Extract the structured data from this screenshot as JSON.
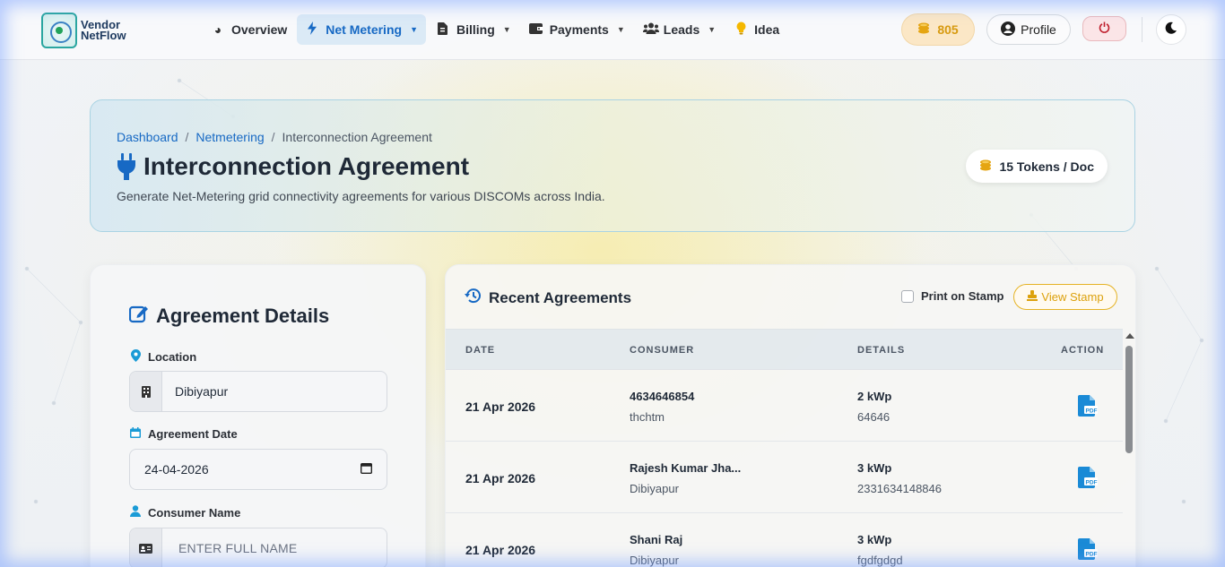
{
  "brand": {
    "line1": "Vendor",
    "line2": "NetFlow"
  },
  "nav": {
    "items": [
      {
        "label": "Overview",
        "icon": "chart-pie-icon",
        "glyph": "◕"
      },
      {
        "label": "Net Metering",
        "icon": "bolt-icon",
        "glyph": "⚡",
        "active": true,
        "dropdown": true
      },
      {
        "label": "Billing",
        "icon": "file-invoice-icon",
        "glyph": "▤",
        "dropdown": true
      },
      {
        "label": "Payments",
        "icon": "wallet-icon",
        "glyph": "▬",
        "dropdown": true
      },
      {
        "label": "Leads",
        "icon": "users-icon",
        "glyph": "👥",
        "dropdown": true
      },
      {
        "label": "Idea",
        "icon": "lightbulb-icon",
        "glyph": "💡"
      }
    ],
    "tokens": "805",
    "profile_label": "Profile"
  },
  "hero": {
    "breadcrumb": [
      "Dashboard",
      "Netmetering",
      "Interconnection Agreement"
    ],
    "title": "Interconnection Agreement",
    "subtitle": "Generate Net-Metering grid connectivity agreements for various DISCOMs across India.",
    "token_cost": "15 Tokens / Doc"
  },
  "form": {
    "title": "Agreement Details",
    "location_label": "Location",
    "location_value": "Dibiyapur",
    "date_label": "Agreement Date",
    "date_value": "24-04-2026",
    "consumer_label": "Consumer Name",
    "consumer_placeholder": "ENTER FULL NAME"
  },
  "recent": {
    "title": "Recent Agreements",
    "print_on_stamp": "Print on Stamp",
    "view_stamp": "View Stamp",
    "columns": [
      "DATE",
      "CONSUMER",
      "DETAILS",
      "ACTION"
    ],
    "rows": [
      {
        "date": "21 Apr 2026",
        "consumer": "4634646854",
        "place": "thchtm",
        "capacity": "2 kWp",
        "ref": "64646"
      },
      {
        "date": "21 Apr 2026",
        "consumer": "Rajesh Kumar Jha...",
        "place": "Dibiyapur",
        "capacity": "3 kWp",
        "ref": "2331634148846"
      },
      {
        "date": "21 Apr 2026",
        "consumer": "Shani Raj",
        "place": "Dibiyapur",
        "capacity": "3 kWp",
        "ref": "fgdfgdgd"
      }
    ]
  },
  "colors": {
    "accent": "#1769c4",
    "gold": "#e0a10f",
    "danger": "#c0212f",
    "teal": "#1a9bd6"
  }
}
